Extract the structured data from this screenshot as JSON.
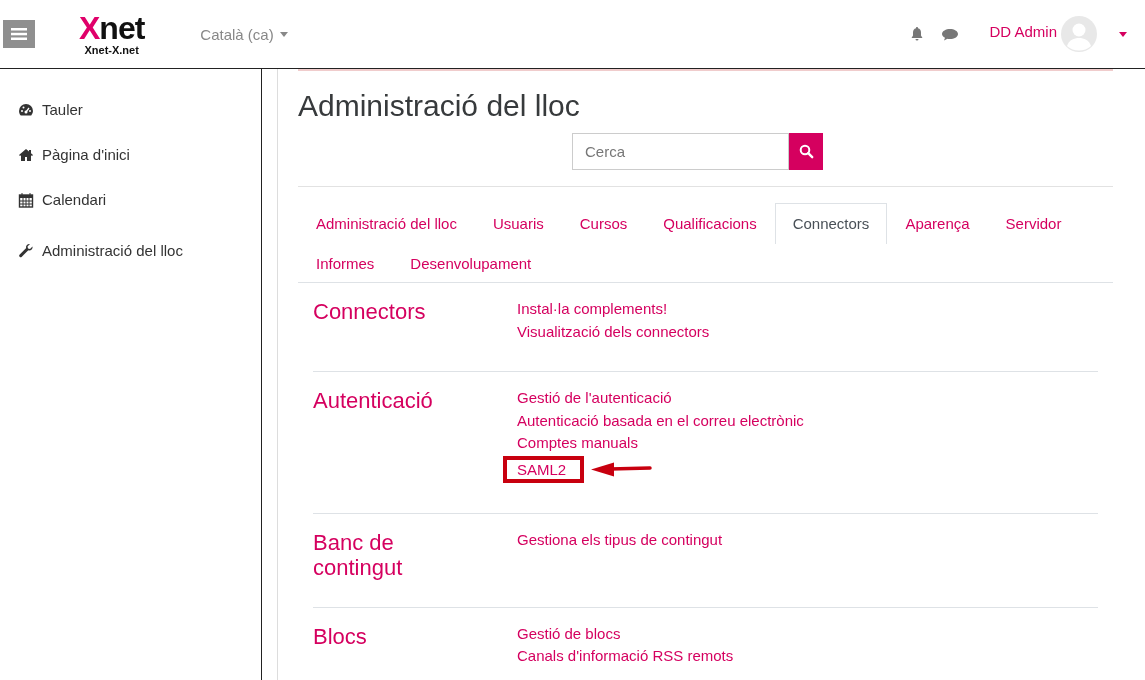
{
  "header": {
    "logo": {
      "mark": "Xnet",
      "tagline": "Xnet-X.net"
    },
    "language": "Català (ca)",
    "user": "DD Admin"
  },
  "sidebar": {
    "items": [
      {
        "label": "Tauler"
      },
      {
        "label": "Pàgina d'inici"
      },
      {
        "label": "Calendari"
      },
      {
        "label": "Administració del lloc"
      }
    ]
  },
  "page": {
    "title": "Administració del lloc",
    "search": {
      "placeholder": "Cerca"
    },
    "tabs": [
      {
        "label": "Administració del lloc",
        "selected": false
      },
      {
        "label": "Usuaris",
        "selected": false
      },
      {
        "label": "Cursos",
        "selected": false
      },
      {
        "label": "Qualificacions",
        "selected": false
      },
      {
        "label": "Connectors",
        "selected": true
      },
      {
        "label": "Aparença",
        "selected": false
      },
      {
        "label": "Servidor",
        "selected": false
      },
      {
        "label": "Informes",
        "selected": false
      },
      {
        "label": "Desenvolupament",
        "selected": false
      }
    ],
    "sections": [
      {
        "heading": "Connectors",
        "links": [
          {
            "label": "Instal·la complements!",
            "highlighted": false
          },
          {
            "label": "Visualització dels connectors",
            "highlighted": false
          }
        ]
      },
      {
        "heading": "Autenticació",
        "links": [
          {
            "label": "Gestió de l'autenticació",
            "highlighted": false
          },
          {
            "label": "Autenticació basada en el correu electrònic",
            "highlighted": false
          },
          {
            "label": "Comptes manuals",
            "highlighted": false
          },
          {
            "label": "SAML2",
            "highlighted": true
          }
        ]
      },
      {
        "heading": "Banc de contingut",
        "links": [
          {
            "label": "Gestiona els tipus de contingut",
            "highlighted": false
          }
        ]
      },
      {
        "heading": "Blocs",
        "links": [
          {
            "label": "Gestió de blocs",
            "highlighted": false
          },
          {
            "label": "Canals d'informació RSS remots",
            "highlighted": false
          }
        ]
      }
    ]
  }
}
